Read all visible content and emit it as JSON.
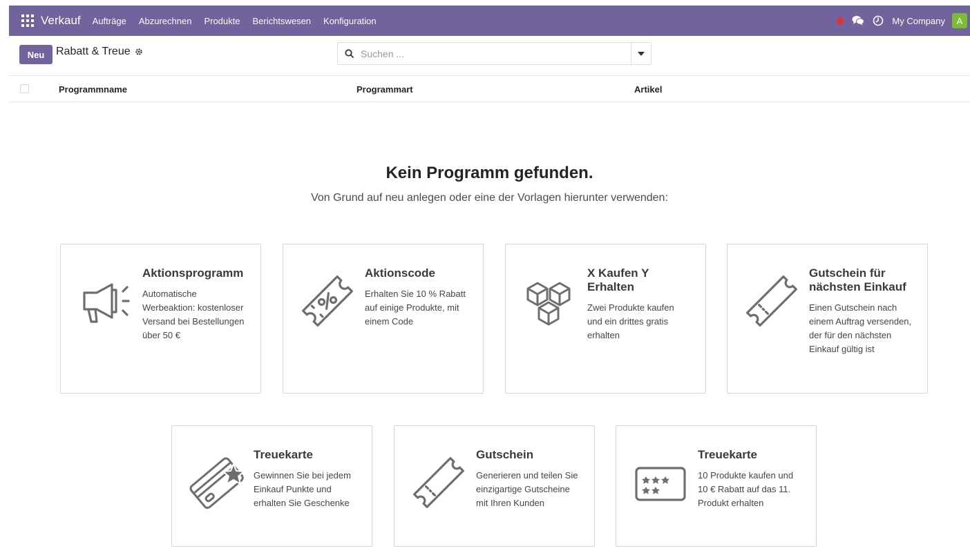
{
  "navbar": {
    "app_name": "Verkauf",
    "menu": [
      "Aufträge",
      "Abzurechnen",
      "Produkte",
      "Berichtswesen",
      "Konfiguration"
    ],
    "company": "My Company",
    "avatar_letter": "A",
    "colors": {
      "bar": "#71639e",
      "record": "#e8312f",
      "avatar": "#7cbd33"
    }
  },
  "control": {
    "new_label": "Neu",
    "breadcrumb": "Rabatt & Treue",
    "search_placeholder": "Suchen ..."
  },
  "list": {
    "columns": [
      "Programmname",
      "Programmart",
      "Artikel"
    ]
  },
  "empty": {
    "title": "Kein Programm gefunden.",
    "subtitle": "Von Grund auf neu anlegen oder eine der Vorlagen hierunter verwenden:"
  },
  "templates": [
    {
      "title": "Aktionsprogramm",
      "description": "Automatische Werbeaktion: kostenloser Versand bei Bestellungen über 50 €",
      "icon": "megaphone-icon"
    },
    {
      "title": "Aktionscode",
      "description": "Erhalten Sie 10 % Rabatt auf einige Produkte, mit einem Code",
      "icon": "percent-ticket-icon"
    },
    {
      "title": "X Kaufen Y Erhalten",
      "description": "Zwei Produkte kaufen und ein drittes gratis erhalten",
      "icon": "boxes-icon"
    },
    {
      "title": "Gutschein für nächsten Einkauf",
      "description": "Einen Gutschein nach einem Auftrag versenden, der für den nächsten Einkauf gültig ist",
      "icon": "ticket-icon"
    },
    {
      "title": "Treuekarte",
      "description": "Gewinnen Sie bei jedem Einkauf Punkte und erhalten Sie Geschenke",
      "icon": "loyalty-card-icon"
    },
    {
      "title": "Gutschein",
      "description": "Generieren und teilen Sie einzigartige Gutscheine mit Ihren Kunden",
      "icon": "ticket-icon"
    },
    {
      "title": "Treuekarte",
      "description": "10 Produkte kaufen und 10 € Rabatt auf das 11. Produkt erhalten",
      "icon": "stamp-card-icon"
    }
  ]
}
